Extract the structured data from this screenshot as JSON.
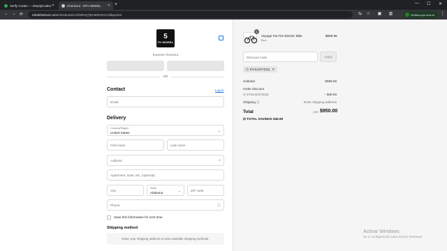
{
  "browser": {
    "tabs": [
      {
        "label": "Verify Codes — SimplyCodes",
        "active": false
      },
      {
        "label": "Checkout - 5TH WHEEL",
        "active": true
      }
    ],
    "new_tab": "+",
    "window_controls": {
      "minimize": "—",
      "maximize": "☐",
      "close": "✕"
    },
    "nav": {
      "back": "←",
      "forward": "→",
      "reload": "⟳"
    },
    "url_domain": "ride5thwheel.com",
    "url_path": "/checkouts/cn/hWN1jTjDn9dtXSGcOdlap1bm",
    "profile_label": "Verifica que eres tú",
    "colors": {
      "tabbar": "#202124",
      "toolbar": "#35363a",
      "profile": "#1e3a27"
    }
  },
  "store": {
    "logo_number": "5",
    "logo_word": "TH WHEEL"
  },
  "express": {
    "label": "Express checkout",
    "or": "OR"
  },
  "contact": {
    "heading": "Contact",
    "login": "Log in",
    "email_placeholder": "Email"
  },
  "delivery": {
    "heading": "Delivery",
    "country_label": "Country/Region",
    "country_value": "United States",
    "first_name_placeholder": "First name",
    "last_name_placeholder": "Last name",
    "address_placeholder": "Address",
    "apartment_placeholder": "Apartment, suite, etc. (optional)",
    "city_placeholder": "City",
    "state_label": "State",
    "state_value": "Alabama",
    "zip_placeholder": "ZIP code",
    "phone_placeholder": "Phone",
    "save_info_label": "Save this information for next time"
  },
  "shipping": {
    "heading": "Shipping method",
    "message": "Enter your shipping address to view available shipping methods."
  },
  "summary": {
    "product": {
      "name": "Voyage Fat Tire Electric Bike",
      "variant": "Blue",
      "price": "$999.99",
      "quantity": "1"
    },
    "discount_placeholder": "Discount code",
    "apply_label": "Apply",
    "applied_code": "5THLISCFD2Q",
    "subtotal_label": "Subtotal",
    "subtotal_value": "$999.99",
    "order_discount_label": "Order discount",
    "order_discount_code": "5THLISCFD2Q",
    "order_discount_value": "− $49.99",
    "shipping_label": "Shipping",
    "shipping_value": "Enter shipping address",
    "total_label": "Total",
    "currency": "USD",
    "total_value": "$950.00",
    "savings_label": "TOTAL SAVINGS",
    "savings_value": "$49.99"
  },
  "windows_watermark": {
    "title": "Activar Windows",
    "subtitle": "Ve a Configuración para activar Windows."
  },
  "colors": {
    "link": "#1a73e8",
    "right_panel": "#f5f5f5"
  }
}
